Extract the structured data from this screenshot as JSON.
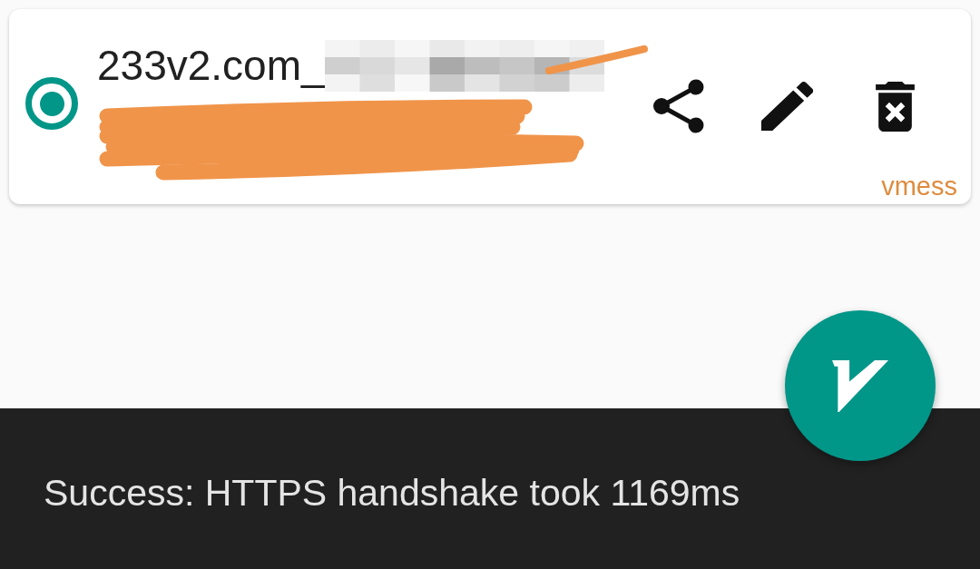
{
  "servers": [
    {
      "name": "233v2.com_",
      "selected": true,
      "type": "vmess"
    }
  ],
  "snackbar": {
    "message": "Success: HTTPS handshake took 1169ms"
  }
}
